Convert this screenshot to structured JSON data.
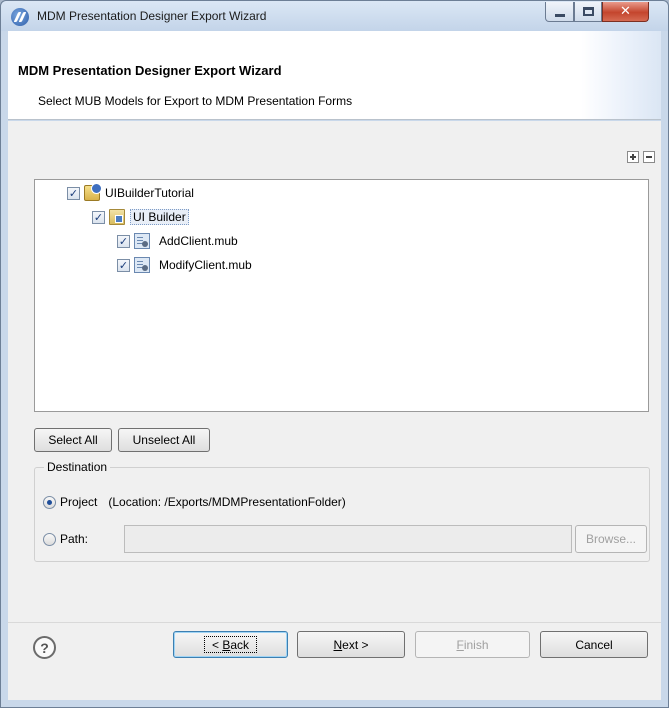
{
  "window": {
    "title": "MDM Presentation Designer Export Wizard",
    "minimize_icon": "minimize-icon",
    "maximize_icon": "maximize-icon",
    "close_icon": "close-icon",
    "close_glyph": "✕"
  },
  "header": {
    "title": "MDM Presentation Designer Export Wizard",
    "subtitle": "Select MUB Models for Export to MDM Presentation Forms"
  },
  "tree": {
    "expand_all_icon": "expand-all-icon",
    "collapse_all_icon": "collapse-all-icon",
    "items": [
      {
        "label": "UIBuilderTutorial",
        "checked": true,
        "icon": "project-icon",
        "depth": 0
      },
      {
        "label": "UI Builder",
        "checked": true,
        "icon": "folder-icon",
        "depth": 1
      },
      {
        "label": "AddClient.mub",
        "checked": true,
        "icon": "mub-file-icon",
        "depth": 2
      },
      {
        "label": "ModifyClient.mub",
        "checked": true,
        "icon": "mub-file-icon",
        "depth": 2
      }
    ],
    "check_glyph": "✓"
  },
  "selection_buttons": {
    "select_all": "Select All",
    "unselect_all": "Unselect All"
  },
  "destination": {
    "legend": "Destination",
    "project_label": "Project",
    "project_location": "(Location: /Exports/MDMPresentationFolder)",
    "path_label": "Path:",
    "path_value": "",
    "browse_label": "Browse..."
  },
  "footer": {
    "help_glyph": "?",
    "back_prefix": "< ",
    "back_mnemonic": "B",
    "back_rest": "ack",
    "next_mnemonic": "N",
    "next_rest": "ext >",
    "finish_mnemonic": "F",
    "finish_rest": "inish",
    "cancel_label": "Cancel"
  }
}
